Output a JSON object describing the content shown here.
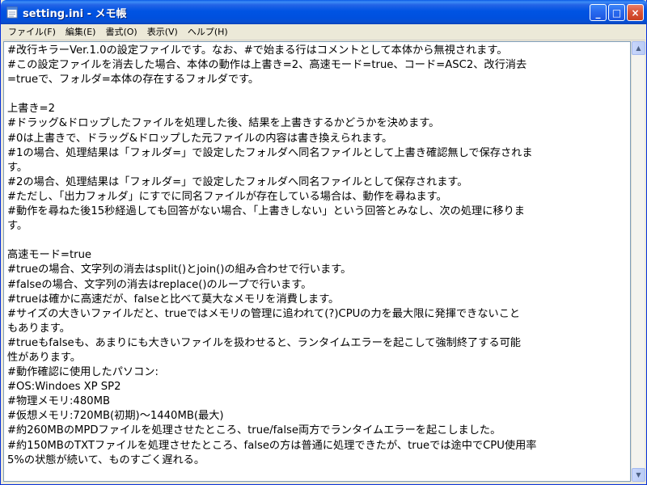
{
  "window": {
    "title": "setting.ini - メモ帳",
    "minimize": "_",
    "maximize": "□",
    "close": "×"
  },
  "menu": [
    {
      "label": "ファイル(F)"
    },
    {
      "label": "編集(E)"
    },
    {
      "label": "書式(O)"
    },
    {
      "label": "表示(V)"
    },
    {
      "label": "ヘルプ(H)"
    }
  ],
  "document": {
    "lines": [
      "#改行キラーVer.1.0の設定ファイルです。なお、#で始まる行はコメントとして本体から無視されます。",
      "#この設定ファイルを消去した場合、本体の動作は上書き=2、高速モード=true、コード=ASC2、改行消去",
      "=trueで、フォルダ=本体の存在するフォルダです。",
      "",
      "上書き=2",
      "#ドラッグ&ドロップしたファイルを処理した後、結果を上書きするかどうかを決めます。",
      "#0は上書きで、ドラッグ&ドロップした元ファイルの内容は書き換えられます。",
      "#1の場合、処理結果は「フォルダ=」で設定したフォルダへ同名ファイルとして上書き確認無しで保存されま",
      "す。",
      "#2の場合、処理結果は「フォルダ=」で設定したフォルダへ同名ファイルとして保存されます。",
      "#ただし、「出力フォルダ」にすでに同名ファイルが存在している場合は、動作を尋ねます。",
      "#動作を尋ねた後15秒経過しても回答がない場合、「上書きしない」という回答とみなし、次の処理に移りま",
      "す。",
      "",
      "高速モード=true",
      "#trueの場合、文字列の消去はsplit()とjoin()の組み合わせで行います。",
      "#falseの場合、文字列の消去はreplace()のループで行います。",
      "#trueは確かに高速だが、falseと比べて莫大なメモリを消費します。",
      "#サイズの大きいファイルだと、trueではメモリの管理に追われて(?)CPUの力を最大限に発揮できないこと",
      "もあります。",
      "#trueもfalseも、あまりにも大きいファイルを扱わせると、ランタイムエラーを起こして強制終了する可能",
      "性があります。",
      "#動作確認に使用したパソコン:",
      "#OS:Windoes XP SP2",
      "#物理メモリ:480MB",
      "#仮想メモリ:720MB(初期)～1440MB(最大)",
      "#約260MBのMPDファイルを処理させたところ、true/false両方でランタイムエラーを起こしました。",
      "#約150MBのTXTファイルを処理させたところ、falseの方は普通に処理できたが、trueでは途中でCPU使用率",
      "5%の状態が続いて、ものすごく遅れる。"
    ]
  },
  "icons": {
    "app": "notepad-icon",
    "scroll_up": "scroll-up-arrow-icon",
    "scroll_down": "scroll-down-arrow-icon"
  }
}
